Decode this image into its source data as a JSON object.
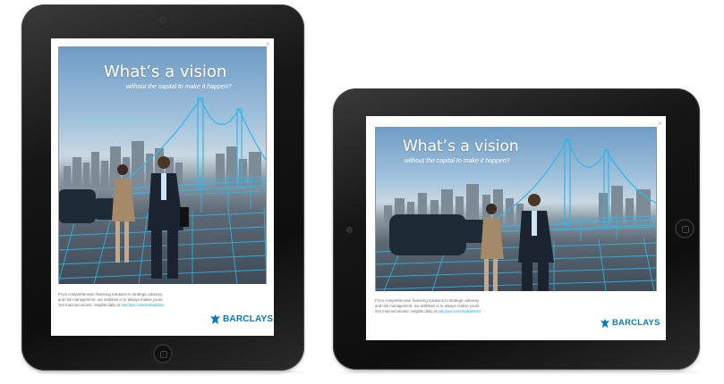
{
  "ad": {
    "headline": "What’s a vision",
    "subline": "without the capital to make it happen?",
    "body_line1": "From comprehensive financing solutions to strategic advisory",
    "body_line2": "and risk management, our ambition is to always realise yours.",
    "body_line3_prefix": "Get macroeconomic insights daily at ",
    "body_link": "barclays.com/realisations",
    "brand": "BARCLAYS",
    "close": "×"
  },
  "colors": {
    "accent": "#31b6e7",
    "brand": "#0a7bbd",
    "bezel": "#161616"
  },
  "icons": [
    "close-icon",
    "barclays-eagle-icon",
    "home-button",
    "camera"
  ]
}
